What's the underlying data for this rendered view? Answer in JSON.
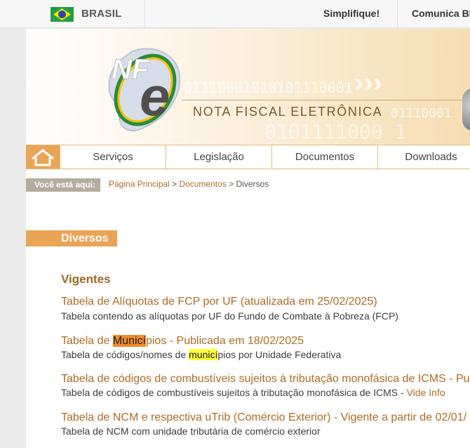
{
  "govbar": {
    "country": "BRASIL",
    "links": [
      "Simplifique!",
      "Comunica BR"
    ]
  },
  "banner": {
    "logo_text": "NFe",
    "subtitle": "NOTA FISCAL ELETRÔNICA",
    "binary_1": "01110001010101110001",
    "binary_2": "01110001",
    "binary_3": "0101111000 1"
  },
  "nav": {
    "home_icon": "home-icon",
    "items": [
      "Serviços",
      "Legislação",
      "Documentos",
      "Downloads"
    ]
  },
  "breadcrumb": {
    "label": "Você está aqui:",
    "items": [
      "Página Principal",
      "Documentos",
      "Diversos"
    ],
    "separator": ">"
  },
  "content": {
    "section_title": "Diversos",
    "subheading": "Vigentes",
    "entries": [
      {
        "title": "Tabela de Alíquotas de FCP por UF (atualizada em 25/02/2025)",
        "desc": "Tabela contendo as alíquotas por UF do Fundo de Combate à Pobreza (FCP)"
      },
      {
        "title_pre": "Tabela de ",
        "title_hl": "Municí",
        "title_post": "pios - Publicada em 18/02/2025",
        "desc_pre": "Tabela de códigos/nomes de ",
        "desc_hl": "municí",
        "desc_post": "pios por Unidade Federativa"
      },
      {
        "title": "Tabela de códigos de combustíveis sujeitos à tributação monofásica de ICMS - Pu",
        "desc": "Tabela de códigos de combustíveis sujeitos à tributação monofásica de ICMS - ",
        "desc_link": "Vide Info"
      },
      {
        "title": "Tabela de NCM e respectiva uTrib (Comércio Exterior) - Vigente a partir de 02/01/",
        "desc": "Tabela de NCM com unidade tributária de comércio exterior"
      }
    ]
  },
  "colors": {
    "accent": "#e9a456",
    "link": "#b06b22",
    "highlight_current": "#f08c2e",
    "highlight_match": "#ffff33"
  }
}
